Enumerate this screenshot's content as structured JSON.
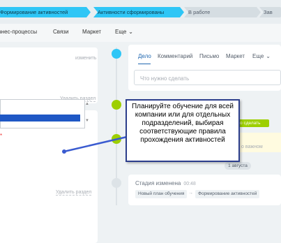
{
  "pipeline": {
    "stages": [
      {
        "label": "Формирование активностей",
        "state": "done"
      },
      {
        "label": "Активности сформированы",
        "state": "done"
      },
      {
        "label": "В работе",
        "state": "todo"
      },
      {
        "label": "Зав",
        "state": "todo"
      }
    ]
  },
  "topnav": {
    "items": [
      "знес-процессы",
      "Связи",
      "Маркет",
      "Еще"
    ]
  },
  "left": {
    "change_link": "изменить",
    "delete_section_1": "Удалить раздел",
    "delete_section_2": "Удалить раздел",
    "required_star": "*"
  },
  "editor": {
    "tabs": [
      "Дело",
      "Комментарий",
      "Письмо",
      "Маркет",
      "Еще"
    ],
    "todo_placeholder": "Что нужно сделать"
  },
  "timeline": {
    "do_badge": "но сделать",
    "important_text": "о важном",
    "date_chip": "1 августа",
    "stage_changed": "Стадия изменена",
    "stage_time": "00:48",
    "from_stage": "Новый план обучения",
    "to_stage": "Формирование активностей"
  },
  "callout": {
    "text": "Планируйте обучение для всей компании или для отдельных подразделений, выбирая соответствующие правила прохождения активностей"
  },
  "colors": {
    "stage_done": "#2fc6f6",
    "stage_todo": "#d5dde2",
    "accent_blue": "#2067b0",
    "green": "#9dcf00",
    "callout_border": "#2c3e8c",
    "select_highlight": "#1f58c5"
  }
}
